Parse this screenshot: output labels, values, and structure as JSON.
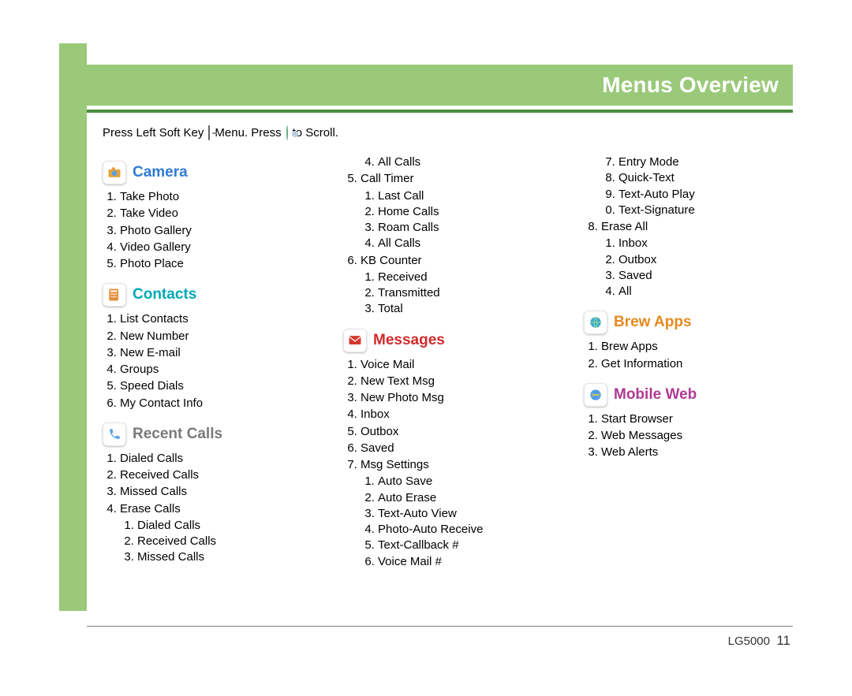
{
  "header": {
    "title": "Menus Overview"
  },
  "instruction": {
    "part1": "Press Left Soft Key",
    "part2": "Menu. Press",
    "part3": "to Scroll."
  },
  "sections": {
    "camera": {
      "label": "Camera",
      "items": [
        "Take Photo",
        "Take Video",
        "Photo Gallery",
        "Video Gallery",
        "Photo Place"
      ]
    },
    "contacts": {
      "label": "Contacts",
      "items": [
        "List Contacts",
        "New Number",
        "New E-mail",
        "Groups",
        "Speed Dials",
        "My Contact Info"
      ]
    },
    "recent_calls": {
      "label": "Recent Calls",
      "items": [
        {
          "label": "Dialed Calls"
        },
        {
          "label": "Received Calls"
        },
        {
          "label": "Missed Calls"
        },
        {
          "label": "Erase Calls",
          "sub": [
            "Dialed Calls",
            "Received Calls",
            "Missed Calls",
            "All Calls"
          ]
        },
        {
          "label": "Call Timer",
          "sub": [
            "Last Call",
            "Home Calls",
            "Roam Calls",
            "All Calls"
          ]
        },
        {
          "label": "KB Counter",
          "sub": [
            "Received",
            "Transmitted",
            "Total"
          ]
        }
      ]
    },
    "messages": {
      "label": "Messages",
      "items": [
        {
          "label": "Voice Mail"
        },
        {
          "label": "New Text Msg"
        },
        {
          "label": "New Photo Msg"
        },
        {
          "label": "Inbox"
        },
        {
          "label": "Outbox"
        },
        {
          "label": "Saved"
        },
        {
          "label": "Msg Settings",
          "sub": [
            "Auto Save",
            "Auto Erase",
            "Text-Auto View",
            "Photo-Auto Receive",
            "Text-Callback #",
            "Voice Mail #",
            "Entry Mode",
            "Quick-Text",
            "Text-Auto Play",
            "Text-Signature"
          ],
          "sub_start": 1
        },
        {
          "label": "Erase All",
          "sub": [
            "Inbox",
            "Outbox",
            "Saved",
            "All"
          ]
        }
      ]
    },
    "brew_apps": {
      "label": "Brew Apps",
      "items": [
        "Brew Apps",
        "Get Information"
      ]
    },
    "mobile_web": {
      "label": "Mobile Web",
      "items": [
        "Start Browser",
        "Web Messages",
        "Web Alerts"
      ]
    }
  },
  "footer": {
    "model": "LG5000",
    "page": "11"
  }
}
